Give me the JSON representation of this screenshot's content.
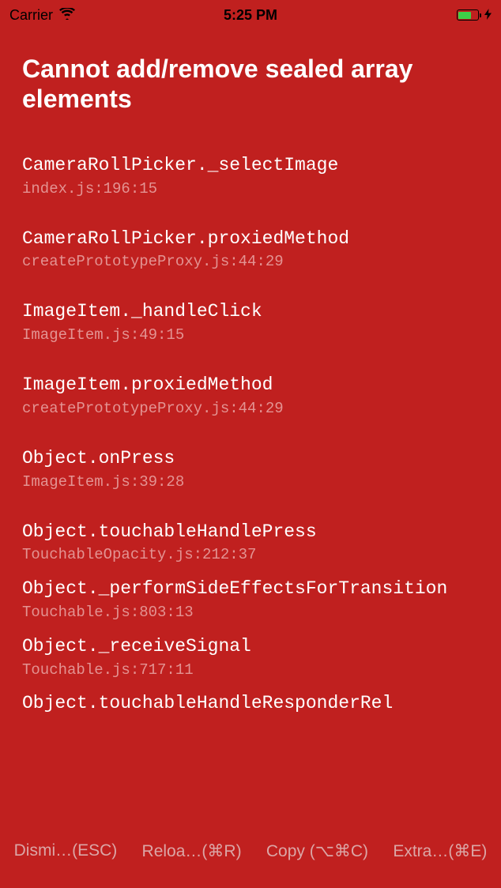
{
  "statusBar": {
    "carrier": "Carrier",
    "time": "5:25 PM"
  },
  "errorTitle": "Cannot add/remove sealed array elements",
  "stackFrames": [
    {
      "method": "CameraRollPicker._selectImage",
      "location": "index.js:196:15"
    },
    {
      "method": "CameraRollPicker.proxiedMethod",
      "location": "createPrototypeProxy.js:44:29"
    },
    {
      "method": "ImageItem._handleClick",
      "location": "ImageItem.js:49:15"
    },
    {
      "method": "ImageItem.proxiedMethod",
      "location": "createPrototypeProxy.js:44:29"
    },
    {
      "method": "Object.onPress",
      "location": "ImageItem.js:39:28"
    },
    {
      "method": "Object.touchableHandlePress",
      "location": "TouchableOpacity.js:212:37"
    },
    {
      "method": "Object._performSideEffectsForTransition",
      "location": "Touchable.js:803:13"
    },
    {
      "method": "Object._receiveSignal",
      "location": "Touchable.js:717:11"
    }
  ],
  "partialFrame": "Object.touchableHandleResponderRel",
  "footer": {
    "dismiss": "Dismi…(ESC)",
    "reload": "Reloa…(⌘R)",
    "copy": "Copy (⌥⌘C)",
    "extra": "Extra…(⌘E)"
  }
}
